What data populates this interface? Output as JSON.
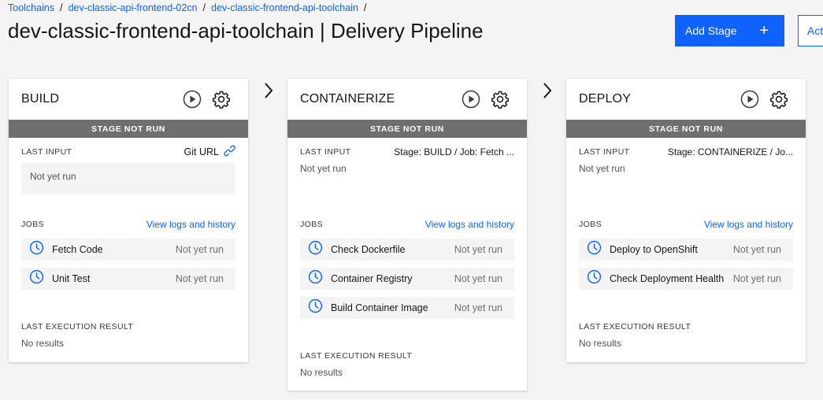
{
  "breadcrumb": [
    {
      "label": "Toolchains"
    },
    {
      "label": "dev-classic-api-frontend-02cn"
    },
    {
      "label": "dev-classic-frontend-api-toolchain"
    }
  ],
  "breadcrumb_sep": "/",
  "page_title": "dev-classic-frontend-api-toolchain | Delivery Pipeline",
  "toolbar": {
    "add_stage_label": "Add Stage",
    "add_stage_icon": "+",
    "actions_label": "Act"
  },
  "labels": {
    "last_input": "LAST INPUT",
    "jobs": "JOBS",
    "view_logs": "View logs and history",
    "last_execution_result": "LAST EXECUTION RESULT",
    "status": "STAGE NOT RUN"
  },
  "colors": {
    "accent": "#0f62fe",
    "status_bar": "#6f6f6f",
    "job_bg": "#f4f4f4"
  },
  "stages": [
    {
      "title": "BUILD",
      "status": "STAGE NOT RUN",
      "input_source": "Git URL",
      "input_value": "Not yet run",
      "jobs": [
        {
          "name": "Fetch Code",
          "status": "Not yet run",
          "icon": "clock-icon"
        },
        {
          "name": "Unit Test",
          "status": "Not yet run",
          "icon": "clock-icon"
        }
      ],
      "result": "No results"
    },
    {
      "title": "CONTAINERIZE",
      "status": "STAGE NOT RUN",
      "input_source": "Stage: BUILD  /  Job: Fetch ...",
      "input_value": "Not yet run",
      "jobs": [
        {
          "name": "Check Dockerfile",
          "status": "Not yet run",
          "icon": "clock-icon"
        },
        {
          "name": "Container Registry",
          "status": "Not yet run",
          "icon": "clock-icon"
        },
        {
          "name": "Build Container Image",
          "status": "Not yet run",
          "icon": "clock-icon"
        }
      ],
      "result": "No results"
    },
    {
      "title": "DEPLOY",
      "status": "STAGE NOT RUN",
      "input_source": "Stage: CONTAINERIZE  /  Jo...",
      "input_value": "Not yet run",
      "jobs": [
        {
          "name": "Deploy to OpenShift",
          "status": "Not yet run",
          "icon": "clock-icon"
        },
        {
          "name": "Check Deployment Health",
          "status": "Not yet run",
          "icon": "clock-icon"
        }
      ],
      "result": "No results"
    }
  ]
}
